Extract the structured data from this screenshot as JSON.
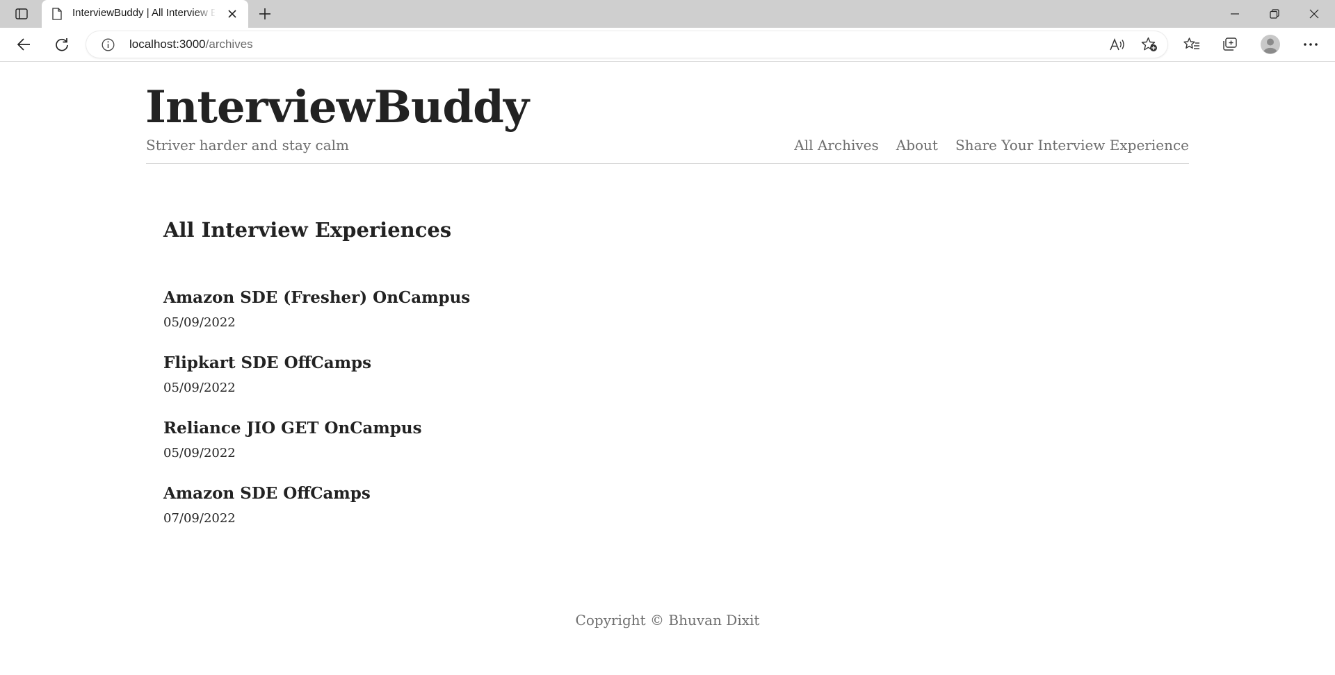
{
  "browser": {
    "tab": {
      "title": "InterviewBuddy | All Interview Experiences",
      "favicon": "page-icon",
      "close_icon": "close-icon"
    },
    "new_tab_icon": "plus-icon",
    "address_bar": {
      "host": "localhost:3000",
      "path": "/archives",
      "info_icon": "info-icon"
    },
    "toolbar_icons": [
      "back-arrow-icon",
      "refresh-icon",
      "read-aloud-icon",
      "add-favorite-icon",
      "favorites-icon",
      "collections-icon",
      "profile-avatar-icon",
      "more-icon"
    ],
    "window_controls": [
      "minimize-icon",
      "restore-icon",
      "close-icon"
    ]
  },
  "site": {
    "title": "InterviewBuddy",
    "tagline": "Striver harder and stay calm",
    "nav": [
      {
        "label": "All Archives"
      },
      {
        "label": "About"
      },
      {
        "label": "Share Your Interview Experience"
      }
    ]
  },
  "main": {
    "heading": "All Interview Experiences",
    "posts": [
      {
        "title": "Amazon SDE (Fresher) OnCampus",
        "date": "05/09/2022"
      },
      {
        "title": "Flipkart SDE OffCamps",
        "date": "05/09/2022"
      },
      {
        "title": "Reliance JIO GET OnCampus",
        "date": "05/09/2022"
      },
      {
        "title": "Amazon SDE OffCamps",
        "date": "07/09/2022"
      }
    ]
  },
  "footer": {
    "text": "Copyright © Bhuvan Dixit"
  },
  "colors": {
    "chrome_background": "#cfcfcf",
    "text_dark": "#222222",
    "text_muted": "#6e6e6e",
    "divider": "#d8d8d8"
  }
}
